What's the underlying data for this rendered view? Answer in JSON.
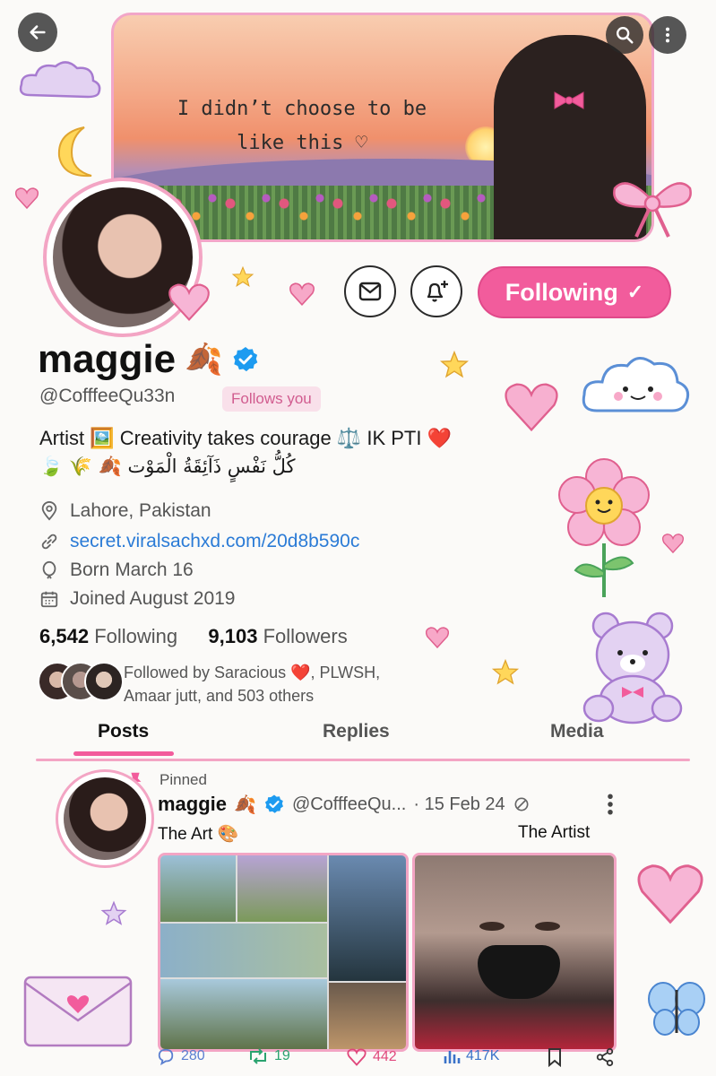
{
  "banner": {
    "text_line1": "I didn’t choose to be",
    "text_line2": "like this ♡"
  },
  "top_buttons": {
    "back": "back-icon",
    "search": "search-icon",
    "more": "more-icon"
  },
  "profile": {
    "name": "maggie",
    "name_emoji": "🍂",
    "handle": "@CofffeeQu33n",
    "follows_you": "Follows you",
    "bio_line1": "Artist 🖼️  Creativity takes courage ⚖️ IK PTI ❤️",
    "bio_line2": "🍃 🌾 🍂 كُلُّ نَفْسٍ ذَآئِقَةُ الْمَوْت",
    "location": "Lahore, Pakistan",
    "website": "secret.viralsachxd.com/20d8b590c",
    "birthday": "Born March 16",
    "joined": "Joined August 2019",
    "following_count": "6,542",
    "following_label": "Following",
    "followers_count": "9,103",
    "followers_label": "Followers",
    "followed_by_line1": "Followed by Saracious ❤️, PLWSH,",
    "followed_by_line2": "Amaar jutt, and 503 others"
  },
  "actions": {
    "following_button": "Following",
    "following_check": "✓"
  },
  "tabs": [
    {
      "label": "Posts"
    },
    {
      "label": "Replies"
    },
    {
      "label": "Media"
    }
  ],
  "post": {
    "pinned_label": "Pinned",
    "author": "maggie",
    "author_emoji": "🍂",
    "handle": "@CofffeeQu...",
    "date": "· 15 Feb 24",
    "text": "The Art 🎨",
    "text_right": "The Artist",
    "replies": "280",
    "reposts": "19",
    "likes": "442",
    "views": "417K"
  },
  "colors": {
    "accent_pink": "#f25c9c",
    "verified_blue": "#1d9bf0",
    "link_blue": "#2b7bd6"
  }
}
